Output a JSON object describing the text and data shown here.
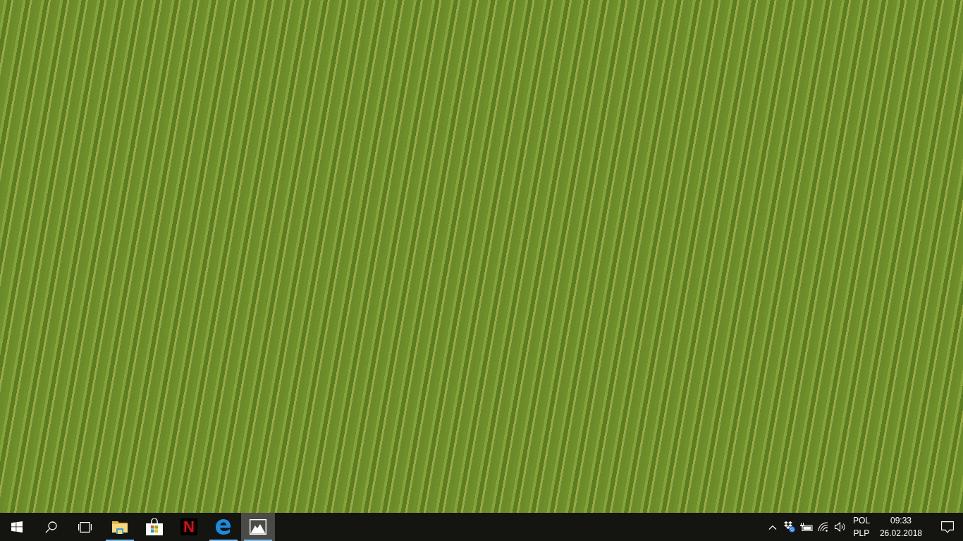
{
  "taskbar": {
    "buttons": [
      {
        "kind": "start"
      },
      {
        "kind": "search"
      },
      {
        "kind": "taskview"
      }
    ],
    "apps": [
      {
        "kind": "folder",
        "running": true,
        "active": false
      },
      {
        "kind": "store",
        "running": false,
        "active": false
      },
      {
        "kind": "netflix",
        "glyph": "N",
        "running": false,
        "active": false
      },
      {
        "kind": "browser",
        "running": true,
        "active": false
      },
      {
        "kind": "photos",
        "running": true,
        "active": true
      }
    ],
    "tray": {
      "icons": [
        {
          "kind": "chevron"
        },
        {
          "kind": "cloud"
        },
        {
          "kind": "battery"
        },
        {
          "kind": "wifi"
        },
        {
          "kind": "volume"
        }
      ],
      "language": [
        "POL",
        "PLP"
      ],
      "time": "09:33",
      "date": "26.02.2018"
    }
  }
}
